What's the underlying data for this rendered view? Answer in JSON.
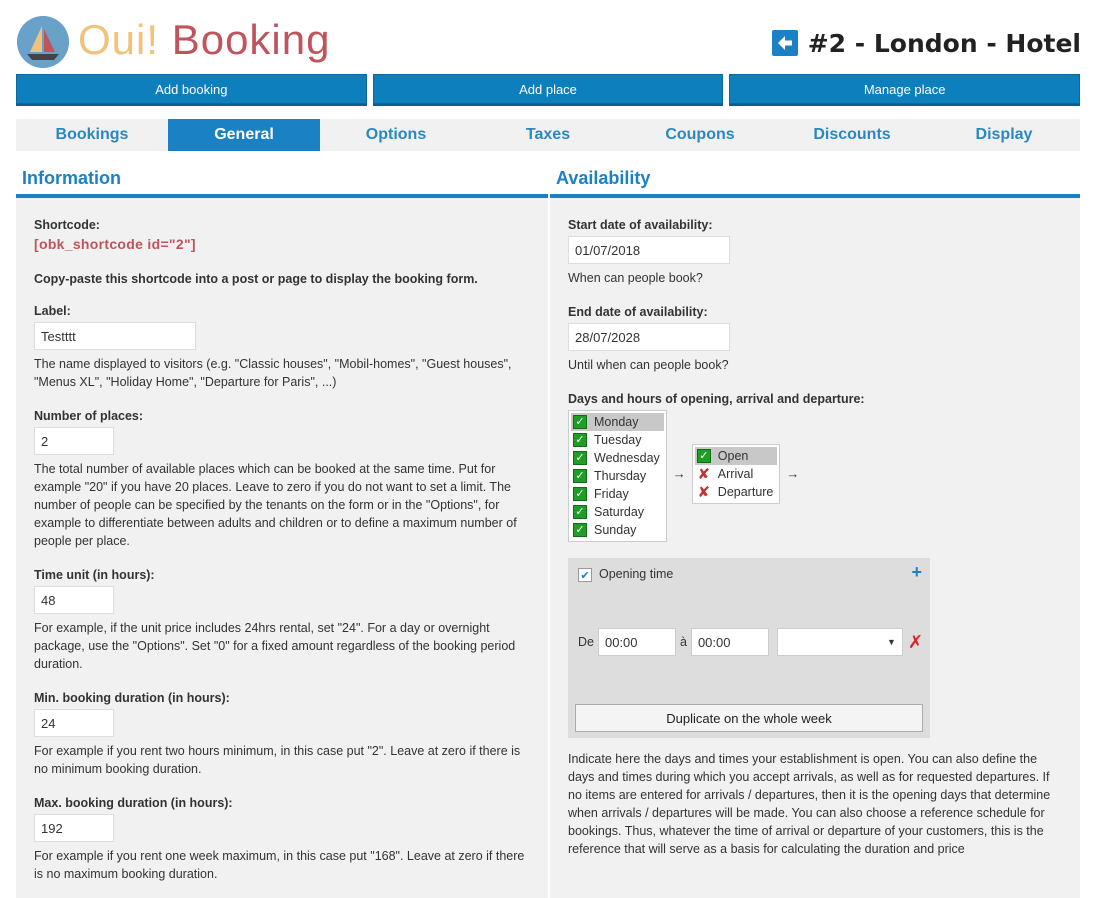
{
  "brand": {
    "part1": "Oui!",
    "part2": "Booking",
    "logo_icon": "sailboat-icon"
  },
  "place": {
    "title": "#2 - London - Hotel",
    "back_icon": "arrow-left-icon"
  },
  "actions": [
    "Add booking",
    "Add place",
    "Manage place"
  ],
  "tabs": [
    "Bookings",
    "General",
    "Options",
    "Taxes",
    "Coupons",
    "Discounts",
    "Display"
  ],
  "active_tab": "General",
  "information": {
    "heading": "Information",
    "shortcode_label": "Shortcode:",
    "shortcode_value": "[obk_shortcode id=\"2\"]",
    "shortcode_note": "Copy-paste this shortcode into a post or page to display the booking form.",
    "label_label": "Label:",
    "label_value": "Testttt",
    "label_help": "The name displayed to visitors (e.g. \"Classic houses\", \"Mobil-homes\", \"Guest houses\", \"Menus XL\", \"Holiday Home\", \"Departure for Paris\", ...)",
    "places_label": "Number of places:",
    "places_value": "2",
    "places_help": "The total number of available places which can be booked at the same time. Put for example \"20\" if you have 20 places. Leave to zero if you do not want to set a limit. The number of people can be specified by the tenants on the form or in the \"Options\", for example to differentiate between adults and children or to define a maximum number of people per place.",
    "timeunit_label": "Time unit (in hours):",
    "timeunit_value": "48",
    "timeunit_help": "For example, if the unit price includes 24hrs rental, set \"24\". For a day or overnight package, use the \"Options\". Set \"0\" for a fixed amount regardless of the booking period duration.",
    "min_label": "Min. booking duration (in hours):",
    "min_value": "24",
    "min_help": "For example if you rent two hours minimum, in this case put \"2\". Leave at zero if there is no minimum booking duration.",
    "max_label": "Max. booking duration (in hours):",
    "max_value": "192",
    "max_help": "For example if you rent one week maximum, in this case put \"168\". Leave at zero if there is no maximum booking duration."
  },
  "availability": {
    "heading": "Availability",
    "start_label": "Start date of availability:",
    "start_value": "01/07/2018",
    "start_help": "When can people book?",
    "end_label": "End date of availability:",
    "end_value": "28/07/2028",
    "end_help": "Until when can people book?",
    "days_label": "Days and hours of opening, arrival and departure:",
    "days": [
      "Monday",
      "Tuesday",
      "Wednesday",
      "Thursday",
      "Friday",
      "Saturday",
      "Sunday"
    ],
    "types": [
      {
        "label": "Open",
        "state": "checked"
      },
      {
        "label": "Arrival",
        "state": "cross"
      },
      {
        "label": "Departure",
        "state": "cross"
      }
    ],
    "arrow": "→",
    "opening_time_label": "Opening time",
    "from_label": "De",
    "from_value": "00:00",
    "to_label": "à",
    "to_value": "00:00",
    "duplicate_label": "Duplicate on the whole week",
    "help": "Indicate here the days and times your establishment is open. You can also define the days and times during which you accept arrivals, as well as for requested departures. If no items are entered for arrivals / departures, then it is the opening days that determine when arrivals / departures will be made. You can also choose a reference schedule for bookings. Thus, whatever the time of arrival or departure of your customers, this is the reference that will serve as a basis for calculating the duration and price"
  },
  "colors": {
    "accent": "#1a82c4",
    "brand_yellow": "#f0c27a",
    "brand_red": "#c0545c",
    "panel_bg": "#f1f1f1"
  }
}
